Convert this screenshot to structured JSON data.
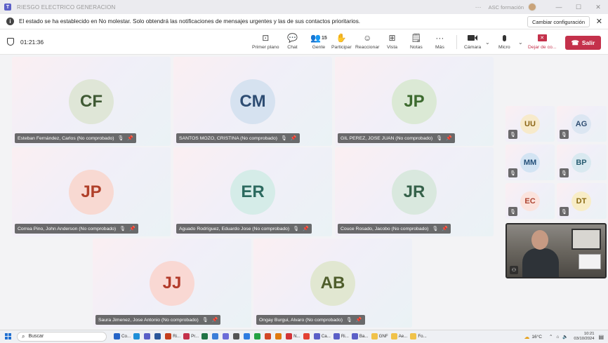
{
  "window": {
    "title": "RIESGO ELECTRICO GENERACION",
    "more": "···",
    "org": "ASC formación",
    "min": "—",
    "max": "☐",
    "close": "✕"
  },
  "banner": {
    "message": "El estado se ha establecido en No molestar. Solo obtendrá las notificaciones de mensajes urgentes y las de sus contactos prioritarios.",
    "button": "Cambiar configuración",
    "close": "✕"
  },
  "toolbar": {
    "timer": "01:21:36",
    "items": [
      {
        "label": "Primer plano",
        "icon": "⊡"
      },
      {
        "label": "Chat",
        "icon": "💬"
      },
      {
        "label": "Gente",
        "icon": "👥",
        "count": "15"
      },
      {
        "label": "Participar",
        "icon": "✋"
      },
      {
        "label": "Reaccionar",
        "icon": "☺"
      },
      {
        "label": "Vista",
        "icon": "⊞"
      },
      {
        "label": "Notas",
        "icon": "🗒"
      },
      {
        "label": "Más",
        "icon": "···"
      },
      {
        "label": "Cámara",
        "icon": "■"
      },
      {
        "label": "Micro",
        "icon": "🎙"
      },
      {
        "label": "Dejar de co...",
        "icon": "✕"
      }
    ],
    "leave": "Salir"
  },
  "participants": [
    {
      "initials": "CF",
      "name": "Esteban Fernández, Carlos (No comprobado)",
      "bg": "#dfe6d7",
      "fg": "#3f5a34"
    },
    {
      "initials": "CM",
      "name": "SANTOS MOZO, CRISTINA (No comprobado)",
      "bg": "#d6e2f0",
      "fg": "#2e4d73"
    },
    {
      "initials": "JP",
      "name": "GIL PEREZ, JOSE JUAN (No comprobado)",
      "bg": "#dbe9d5",
      "fg": "#3d6b2f"
    },
    {
      "initials": "JP",
      "name": "Correa Pino, John Anderson (No comprobado)",
      "bg": "#f8d9d2",
      "fg": "#b0402a"
    },
    {
      "initials": "ER",
      "name": "Aguado Rodríguez, Eduardo Jose (No comprobado)",
      "bg": "#d5ece8",
      "fg": "#2d6b60"
    },
    {
      "initials": "JR",
      "name": "Couce Rosado, Jacobo (No comprobado)",
      "bg": "#d9e8de",
      "fg": "#36624a"
    },
    {
      "initials": "JJ",
      "name": "Saura Jimenez, Jose Antonio (No comprobado)",
      "bg": "#f9d8d3",
      "fg": "#b23a2a"
    },
    {
      "initials": "AB",
      "name": "Ongay Burgui, Alvaro (No comprobado)",
      "bg": "#e1e7d1",
      "fg": "#4f5e2c"
    }
  ],
  "small_participants": [
    {
      "initials": "UU",
      "bg": "#f7eacb",
      "fg": "#8a6415"
    },
    {
      "initials": "AG",
      "bg": "#dce6f2",
      "fg": "#2f4d72"
    },
    {
      "initials": "MM",
      "bg": "#d3e4f3",
      "fg": "#245079"
    },
    {
      "initials": "BP",
      "bg": "#d9e9f0",
      "fg": "#2a5e73"
    },
    {
      "initials": "EC",
      "bg": "#fbe3dd",
      "fg": "#ae4431"
    },
    {
      "initials": "DT",
      "bg": "#f8edc7",
      "fg": "#8a6a12"
    }
  ],
  "taskbar": {
    "search": "Buscar",
    "apps": [
      {
        "label": "Co...",
        "color": "#2564c7"
      },
      {
        "label": "",
        "color": "#1e8fd8"
      },
      {
        "label": "",
        "color": "#5b5fc7"
      },
      {
        "label": "",
        "color": "#2b579a"
      },
      {
        "label": "Ri...",
        "color": "#c43e1c"
      },
      {
        "label": "Pr...",
        "color": "#c4314b"
      },
      {
        "label": "",
        "color": "#217346"
      },
      {
        "label": "",
        "color": "#3b7dd8"
      },
      {
        "label": "",
        "color": "#6b6bd8"
      },
      {
        "label": "",
        "color": "#555555"
      },
      {
        "label": "",
        "color": "#2f7ce0"
      },
      {
        "label": "",
        "color": "#25a244"
      },
      {
        "label": "",
        "color": "#d24726"
      },
      {
        "label": "",
        "color": "#e07a10"
      },
      {
        "label": "N...",
        "color": "#d13438"
      },
      {
        "label": "",
        "color": "#e34133"
      },
      {
        "label": "Ca...",
        "color": "#5b5fc7"
      },
      {
        "label": "Ri...",
        "color": "#5b5fc7"
      },
      {
        "label": "Ba...",
        "color": "#5b5fc7"
      },
      {
        "label": "GNF",
        "color": "#f0c24a"
      },
      {
        "label": "Ae...",
        "color": "#f0c24a"
      },
      {
        "label": "Fo...",
        "color": "#f0c24a"
      }
    ],
    "weather": "16°C",
    "time": "10:21",
    "date": "03/10/2024"
  },
  "colors": {
    "accent": "#5b5fc7",
    "leave": "#c4314b"
  }
}
